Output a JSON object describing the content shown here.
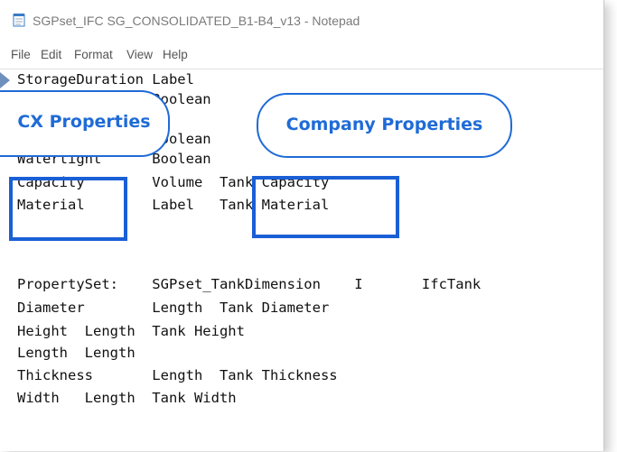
{
  "window": {
    "title": "SGPset_IFC SG_CONSOLIDATED_B1-B4_v13 - Notepad",
    "icon": "notepad-icon"
  },
  "menu": {
    "file": "File",
    "edit": "Edit",
    "format": "Format",
    "view": "View",
    "help": "Help"
  },
  "lines": [
    "StorageDuration Label",
    "                Boolean",
    "                Boolean",
    "Watertight      Boolean",
    "Capacity        Volume  Tank Capacity",
    "Material        Label   Tank Material",
    "",
    "",
    "PropertySet:    SGPset_TankDimension    I       IfcTank",
    "Diameter        Length  Tank Diameter",
    "Height  Length  Tank Height",
    "Length  Length",
    "Thickness       Length  Tank Thickness",
    "Width   Length  Tank Width"
  ],
  "callouts": {
    "cx": "CX Properties",
    "company": "Company Properties"
  },
  "colors": {
    "accent": "#1f6bd6",
    "highlight": "#1a5fd6"
  }
}
